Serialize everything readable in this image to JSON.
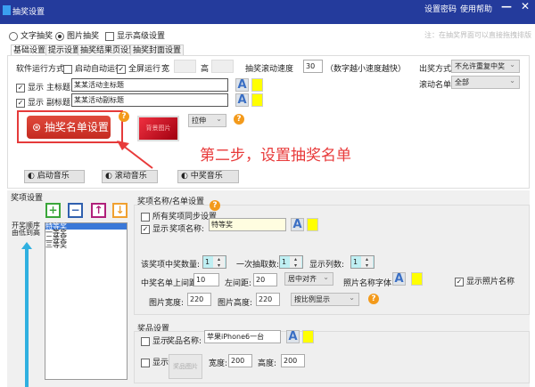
{
  "window": {
    "title": "抽奖设置",
    "set_password": "设置密码",
    "help": "使用帮助",
    "minimize": "—",
    "close": "✕"
  },
  "mode": {
    "text_draw": "文字抽奖",
    "image_draw": "图片抽奖",
    "show_advanced": "显示高级设置",
    "selected": "图片抽奖",
    "note": "注：在抽奖界面可以直接拖拽排版"
  },
  "tabs": [
    "基础设置",
    "提示设置",
    "抽奖结果页设置",
    "抽奖封面设置"
  ],
  "basic": {
    "run_mode_label": "软件运行方式",
    "auto_start": "启动自动运行",
    "fullscreen": "全屏运行",
    "width_label": "宽",
    "height_label": "高",
    "scroll_speed_label": "抽奖滚动速度",
    "scroll_speed": "30",
    "speed_hint": "（数字越小速度越快）",
    "draw_mode_label": "出奖方式",
    "draw_mode": "不允许重复中奖",
    "scroll_list_label": "滚动名单",
    "scroll_list": "全部",
    "show": "显示",
    "main_title_label": "主标题",
    "main_title": "某某活动主标题",
    "sub_title_label": "副标题",
    "sub_title": "某某活动副标题",
    "list_button": "抽奖名单设置",
    "bg_image": "背景图片",
    "stretch": "拉伸",
    "annotation": "第二步，设置抽奖名单",
    "music": [
      "启动音乐",
      "滚动音乐",
      "中奖音乐"
    ]
  },
  "prizes": {
    "section_label": "奖项设置",
    "order_label": [
      "开奖顺序",
      "由低到高"
    ],
    "items": [
      "特等奖",
      "一等奖",
      "二等奖",
      "三等奖"
    ],
    "selected_index": 0,
    "name_group_label": "奖项名称/名单设置",
    "sync_all": "所有奖项同步设置",
    "show": "显示",
    "prize_name_label": "奖项名称:",
    "prize_name": "特等奖",
    "win_count_label": "该奖项中奖数量:",
    "win_count": "1",
    "per_draw_label": "一次抽取数:",
    "per_draw": "1",
    "columns_label": "显示列数:",
    "columns": "1",
    "top_margin_label": "中奖名单上间距:",
    "top_margin": "10",
    "left_margin_label": "左间距:",
    "left_margin": "20",
    "align": "居中对齐",
    "photo_font_label": "照片名称字体",
    "show_photo_name": "显示照片名称",
    "img_width_label": "图片宽度:",
    "img_width": "220",
    "img_height_label": "图片高度:",
    "img_height": "220",
    "scale_mode": "按比例显示",
    "gift_group_label": "奖品设置",
    "gift_name_label": "奖品名称:",
    "gift_name": "苹果iPhone6一台",
    "gift_image": "奖品图片",
    "gift_width_label": "宽度:",
    "gift_width": "200",
    "gift_height_label": "高度:",
    "gift_height": "200"
  },
  "colors": {
    "titlebar": "#243b9c",
    "accent_red": "#e83a3a",
    "swatch": "#ffff00"
  }
}
